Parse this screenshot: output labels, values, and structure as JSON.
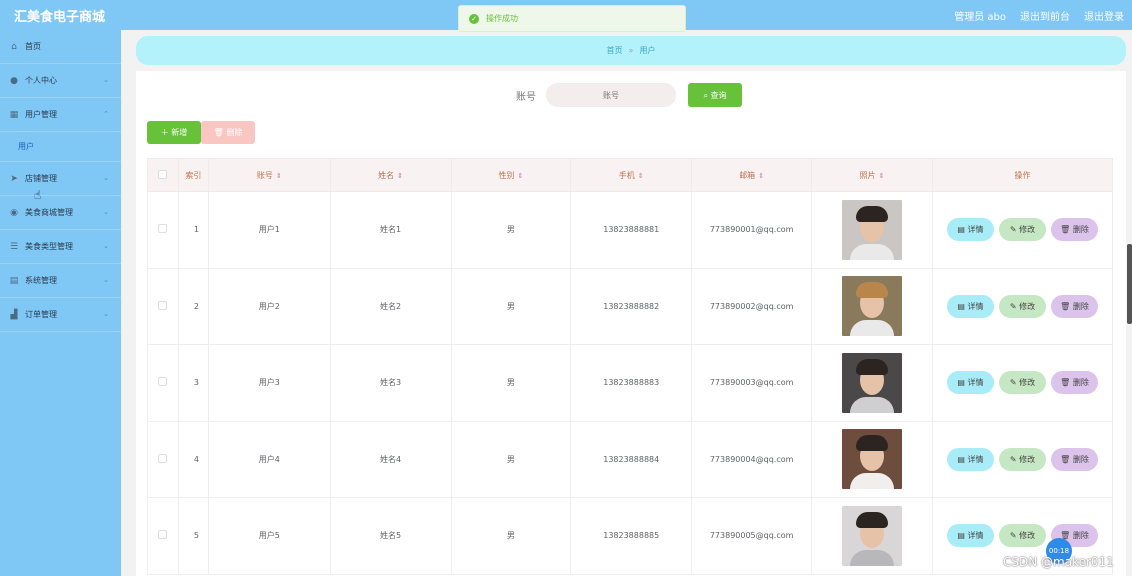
{
  "app": {
    "title": "汇美食电子商城"
  },
  "header": {
    "admin": "管理员 abo",
    "exit_backend": "退出到前台",
    "logout": "退出登录"
  },
  "toast": {
    "message": "操作成功"
  },
  "sidebar": {
    "items": [
      {
        "label": "首页",
        "icon": "home-icon"
      },
      {
        "label": "个人中心",
        "icon": "user-icon"
      },
      {
        "label": "用户管理",
        "icon": "grid-icon",
        "children": [
          "用户"
        ]
      },
      {
        "label": "店铺管理",
        "icon": "send-icon"
      },
      {
        "label": "美食商城管理",
        "icon": "pin-icon"
      },
      {
        "label": "美食类型管理",
        "icon": "menu-icon"
      },
      {
        "label": "系统管理",
        "icon": "doc-icon"
      },
      {
        "label": "订单管理",
        "icon": "chart-icon"
      }
    ]
  },
  "breadcrumb": {
    "home": "首页",
    "sep": "»",
    "current": "用户"
  },
  "search": {
    "label": "账号",
    "placeholder": "账号",
    "button": "查询"
  },
  "actions": {
    "add": "新增",
    "delete": "删除"
  },
  "table": {
    "columns": [
      "索引",
      "账号",
      "姓名",
      "性别",
      "手机",
      "邮箱",
      "照片",
      "操作"
    ],
    "rows": [
      {
        "index": "1",
        "account": "用户1",
        "name": "姓名1",
        "gender": "男",
        "phone": "13823888881",
        "email": "773890001@qq.com"
      },
      {
        "index": "2",
        "account": "用户2",
        "name": "姓名2",
        "gender": "男",
        "phone": "13823888882",
        "email": "773890002@qq.com"
      },
      {
        "index": "3",
        "account": "用户3",
        "name": "姓名3",
        "gender": "男",
        "phone": "13823888883",
        "email": "773890003@qq.com"
      },
      {
        "index": "4",
        "account": "用户4",
        "name": "姓名4",
        "gender": "男",
        "phone": "13823888884",
        "email": "773890004@qq.com"
      },
      {
        "index": "5",
        "account": "用户5",
        "name": "姓名5",
        "gender": "男",
        "phone": "13823888885",
        "email": "773890005@qq.com"
      }
    ],
    "row_buttons": {
      "detail": "详情",
      "edit": "修改",
      "delete": "删除"
    }
  },
  "overlay": {
    "timer": "00:18",
    "watermark": "CSDN @maker011"
  },
  "colors": {
    "sidebar": "#7fc7f5",
    "success": "#67c23a",
    "breadcrumb_bg": "#b3f1fb"
  }
}
